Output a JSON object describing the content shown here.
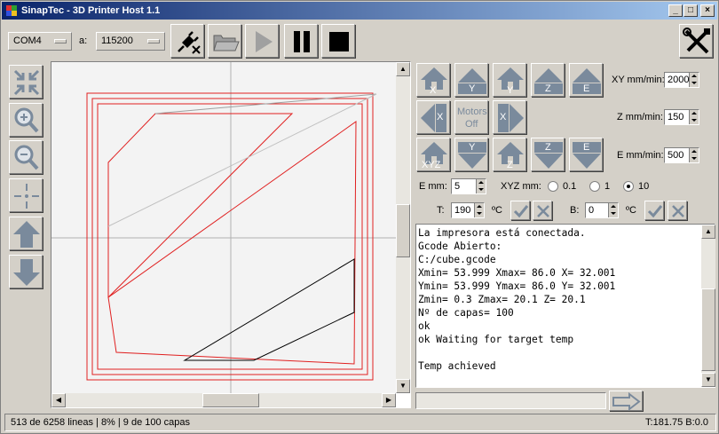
{
  "window": {
    "title": "SinapTec - 3D Printer Host 1.1",
    "min_label": "_",
    "max_label": "□",
    "close_label": "×"
  },
  "toolbar": {
    "port_value": "COM4",
    "baud_label": "a:",
    "baud_value": "115200"
  },
  "jog": {
    "home_x": "X",
    "y_plus": "Y",
    "home_y": "Y",
    "z_plus": "Z",
    "e_plus": "E",
    "x_minus": "X",
    "motors_off_line1": "Motors",
    "motors_off_line2": "Off",
    "x_plus": "X",
    "home_xyz": "XYZ",
    "y_minus": "Y",
    "home_z": "Z",
    "z_minus": "Z",
    "e_minus": "E"
  },
  "feeds": {
    "xy_label": "XY mm/min:",
    "xy_value": "2000",
    "z_label": "Z mm/min:",
    "z_value": "150",
    "e_label": "E mm/min:",
    "e_value": "500"
  },
  "steps": {
    "e_mm_label": "E mm:",
    "e_mm_value": "5",
    "xyz_label": "XYZ mm:",
    "opt_01": "0.1",
    "opt_1": "1",
    "opt_10": "10",
    "selected": "10"
  },
  "temps": {
    "t_label": "T:",
    "t_value": "190",
    "t_unit": "ºC",
    "b_label": "B:",
    "b_value": "0",
    "b_unit": "ºC"
  },
  "console_lines": [
    "La impresora está conectada.",
    "Gcode Abierto:",
    "C:/cube.gcode",
    "Xmin= 53.999 Xmax= 86.0 X= 32.001",
    "Ymin= 53.999 Ymax= 86.0 Y= 32.001",
    "Zmin= 0.3 Zmax= 20.1 Z= 20.1",
    "Nº de capas= 100",
    "ok",
    "ok Waiting for target temp",
    "",
    "Temp achieved"
  ],
  "status": {
    "left": "513 de 6258 lineas | 8% | 9 de 100 capas",
    "right": "T:181.75 B:0.0"
  },
  "colors": {
    "path_red": "#e02020",
    "path_black": "#000000",
    "jog_blue": "#7a8a9c"
  }
}
